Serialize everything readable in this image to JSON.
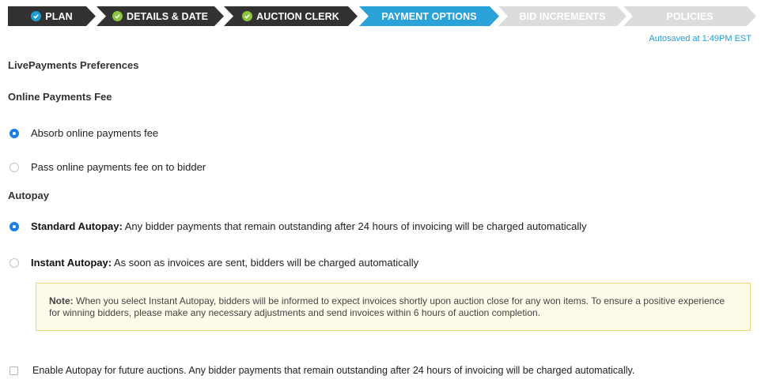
{
  "stepper": [
    {
      "label": "PLAN",
      "state": "done"
    },
    {
      "label": "DETAILS & DATE",
      "state": "done"
    },
    {
      "label": "AUCTION CLERK",
      "state": "done"
    },
    {
      "label": "PAYMENT OPTIONS",
      "state": "active"
    },
    {
      "label": "BID INCREMENTS",
      "state": "todo"
    },
    {
      "label": "POLICIES",
      "state": "todo"
    }
  ],
  "autosave": "Autosaved at 1:49PM EST",
  "section_title": "LivePayments Preferences",
  "fee": {
    "heading": "Online Payments Fee",
    "options": [
      {
        "label": "Absorb online payments fee",
        "selected": true
      },
      {
        "label": "Pass online payments fee on to bidder",
        "selected": false
      }
    ]
  },
  "autopay": {
    "heading": "Autopay",
    "options": [
      {
        "title": "Standard Autopay:",
        "desc": " Any bidder payments that remain outstanding after 24 hours of invoicing will be charged automatically",
        "selected": true
      },
      {
        "title": "Instant Autopay:",
        "desc": " As soon as invoices are sent, bidders will be charged automatically",
        "selected": false
      }
    ],
    "note_label": "Note:",
    "note_text": " When you select Instant Autopay, bidders will be informed to expect invoices shortly upon auction close for any won items. To ensure a positive experience for winning bidders, please make any necessary adjustments and send invoices within 6 hours of auction completion."
  },
  "future": {
    "label": "Enable Autopay for future auctions. Any bidder payments that remain outstanding after 24 hours of invoicing will be charged automatically.",
    "checked": false
  },
  "colors": {
    "done": "#323232",
    "active": "#2aa1d9",
    "todo": "#dcdcdc",
    "check": "#8cc63f",
    "accent": "#1a7fe6"
  }
}
